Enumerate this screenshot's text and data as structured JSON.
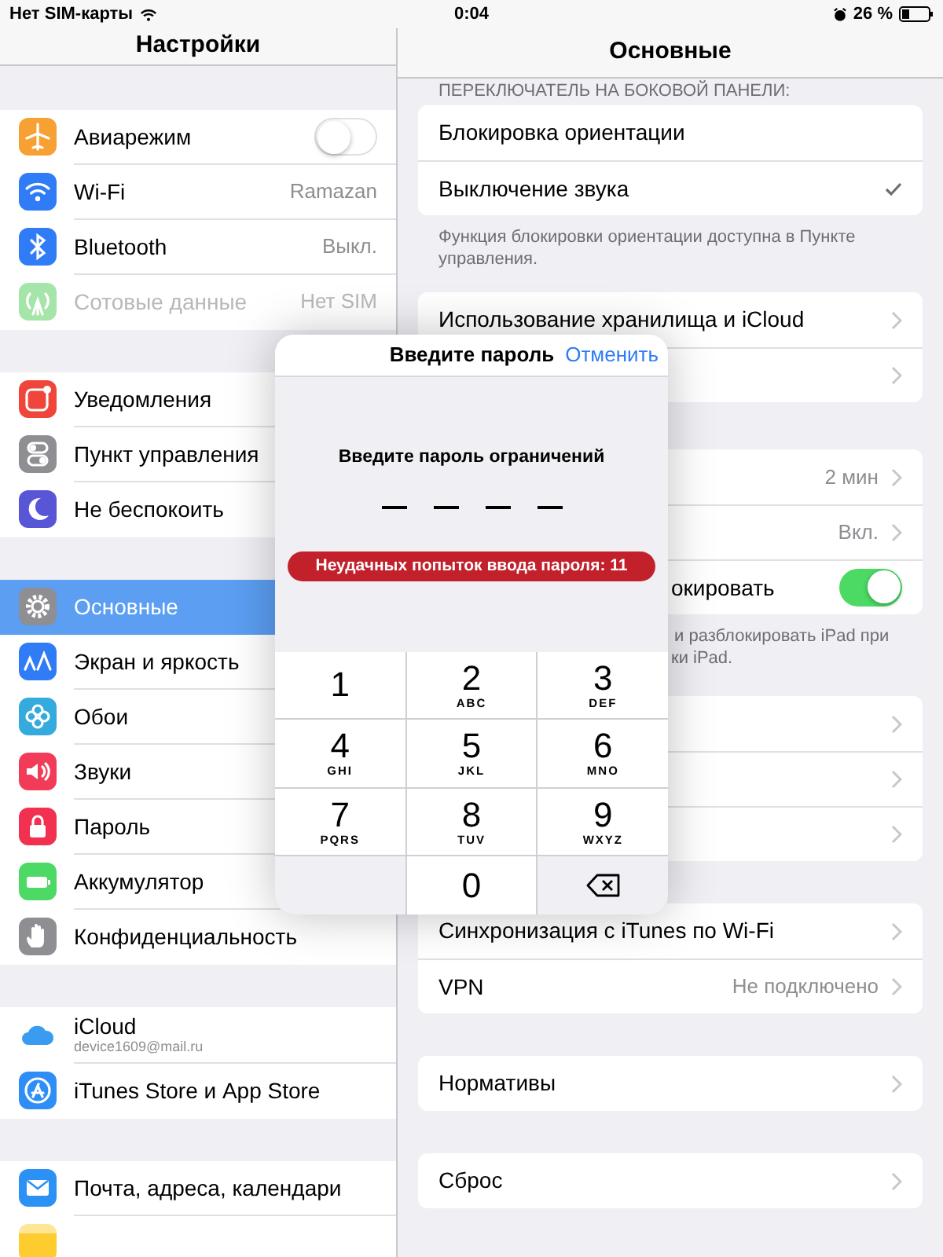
{
  "status_bar": {
    "carrier": "Нет SIM-карты",
    "time": "0:04",
    "battery": "26 %"
  },
  "sidebar": {
    "title": "Настройки",
    "groups": [
      [
        {
          "label": "Авиарежим",
          "kind": "toggle",
          "on": false,
          "color": "#f7a033",
          "selected": false
        },
        {
          "label": "Wi-Fi",
          "kind": "value",
          "value": "Ramazan",
          "color": "#2f7cf6",
          "selected": false
        },
        {
          "label": "Bluetooth",
          "kind": "value",
          "value": "Выкл.",
          "color": "#2f7cf6",
          "selected": false
        },
        {
          "label": "Сотовые данные",
          "kind": "value",
          "value": "Нет SIM",
          "color": "#a6e5aa",
          "selected": false,
          "disabled": true
        }
      ],
      [
        {
          "label": "Уведомления",
          "kind": "plain",
          "color": "#f0453a",
          "selected": false
        },
        {
          "label": "Пункт управления",
          "kind": "plain",
          "color": "#8e8e93",
          "selected": false
        },
        {
          "label": "Не беспокоить",
          "kind": "plain",
          "color": "#5856d6",
          "selected": false
        }
      ],
      [
        {
          "label": "Основные",
          "kind": "plain",
          "color": "#8e8e93",
          "selected": true
        },
        {
          "label": "Экран и яркость",
          "kind": "plain",
          "color": "#2f7cf6",
          "selected": false
        },
        {
          "label": "Обои",
          "kind": "plain",
          "color": "#35aadc",
          "selected": false
        },
        {
          "label": "Звуки",
          "kind": "plain",
          "color": "#f23b58",
          "selected": false
        },
        {
          "label": "Пароль",
          "kind": "plain",
          "color": "#f2304f",
          "selected": false
        },
        {
          "label": "Аккумулятор",
          "kind": "plain",
          "color": "#4cd964",
          "selected": false
        },
        {
          "label": "Конфиденциальность",
          "kind": "plain",
          "color": "#8e8e93",
          "selected": false
        }
      ],
      [
        {
          "label": "iCloud",
          "kind": "account",
          "subtitle": "device1609@mail.ru",
          "color": "#3a9cf0",
          "selected": false
        },
        {
          "label": "iTunes Store и App Store",
          "kind": "plain",
          "color": "#2f8ef6",
          "selected": false
        }
      ],
      [
        {
          "label": "Почта, адреса, календари",
          "kind": "plain",
          "color": "#2c91f5",
          "selected": false
        },
        {
          "kind": "plain",
          "color": "#fecc2f",
          "selected": false
        }
      ]
    ]
  },
  "detail": {
    "title": "Основные",
    "sections": [
      {
        "header": "ПЕРЕКЛЮЧАТЕЛЬ НА БОКОВОЙ ПАНЕЛИ:",
        "rows": [
          {
            "label": "Блокировка ориентации",
            "kind": "check",
            "selected": false
          },
          {
            "label": "Выключение звука",
            "kind": "check",
            "selected": true
          }
        ],
        "footer": "Функция блокировки ориентации доступна в Пункте управления."
      },
      {
        "rows": [
          {
            "label": "Использование хранилища и iCloud",
            "kind": "chevron"
          },
          {
            "kind": "chevron"
          }
        ]
      },
      {
        "rows": [
          {
            "value": "2 мин",
            "kind": "chevron"
          },
          {
            "value": "Вкл.",
            "kind": "chevron"
          },
          {
            "label": "окировать",
            "kind": "toggle",
            "on": true
          }
        ],
        "footer_lines": [
          "и разблокировать iPad при",
          "ки iPad."
        ]
      },
      {
        "rows": [
          {
            "kind": "chevron"
          },
          {
            "kind": "chevron"
          },
          {
            "kind": "chevron"
          }
        ]
      },
      {
        "rows": [
          {
            "label": "Синхронизация с iTunes по Wi-Fi",
            "kind": "chevron"
          },
          {
            "label": "VPN",
            "value": "Не подключено",
            "kind": "chevron"
          }
        ]
      },
      {
        "rows": [
          {
            "label": "Нормативы",
            "kind": "chevron"
          }
        ]
      },
      {
        "rows": [
          {
            "label": "Сброс",
            "kind": "chevron"
          }
        ]
      }
    ]
  },
  "dialog": {
    "title": "Введите пароль",
    "cancel": "Отменить",
    "prompt": "Введите пароль ограничений",
    "slots": [
      {
        "filled": false
      },
      {
        "filled": false
      },
      {
        "filled": false
      },
      {
        "filled": false
      }
    ],
    "error": "Неудачных попыток ввода пароля: 11",
    "keys": [
      {
        "kind": "digit",
        "digit": "1"
      },
      {
        "kind": "digit",
        "digit": "2",
        "letters": "ABC"
      },
      {
        "kind": "digit",
        "digit": "3",
        "letters": "DEF"
      },
      {
        "kind": "digit",
        "digit": "4",
        "letters": "GHI"
      },
      {
        "kind": "digit",
        "digit": "5",
        "letters": "JKL"
      },
      {
        "kind": "digit",
        "digit": "6",
        "letters": "MNO"
      },
      {
        "kind": "digit",
        "digit": "7",
        "letters": "PQRS"
      },
      {
        "kind": "digit",
        "digit": "8",
        "letters": "TUV"
      },
      {
        "kind": "digit",
        "digit": "9",
        "letters": "WXYZ"
      },
      {
        "kind": "blank"
      },
      {
        "kind": "digit",
        "digit": "0"
      },
      {
        "kind": "delete"
      }
    ]
  }
}
